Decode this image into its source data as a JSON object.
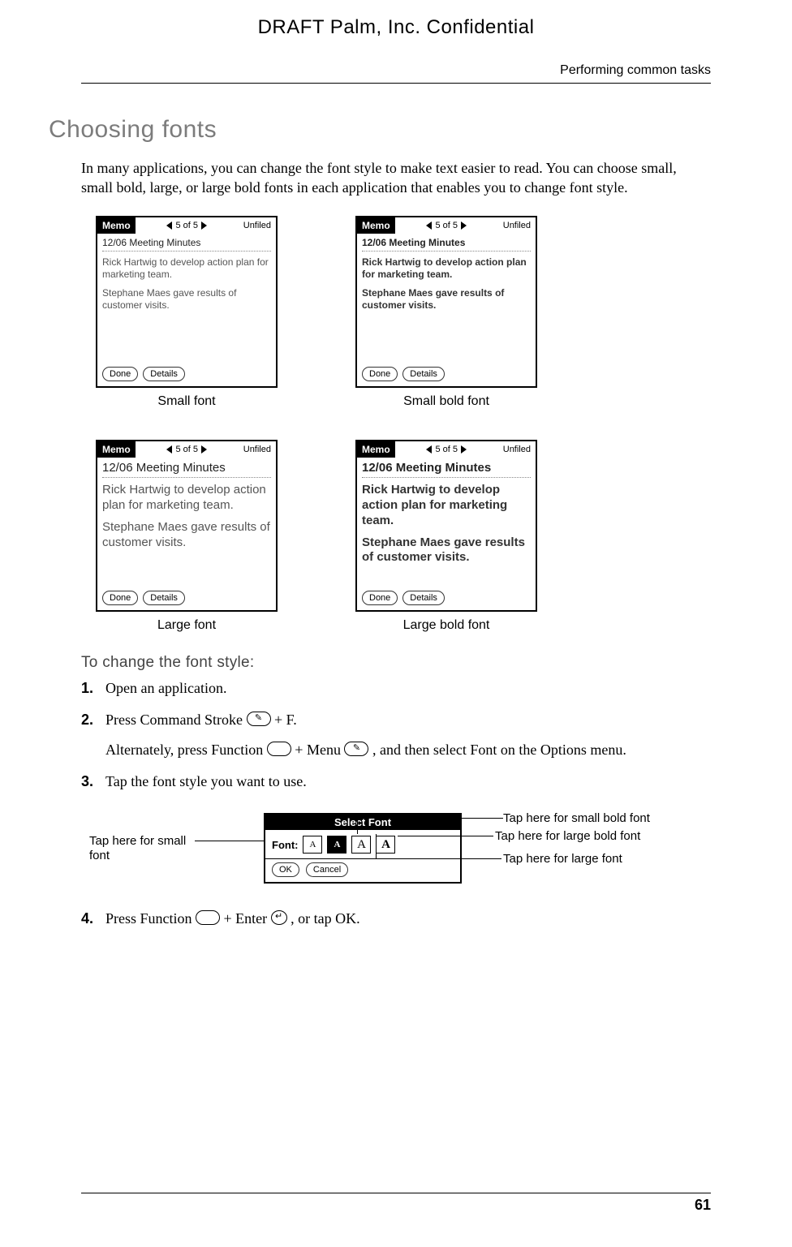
{
  "header": {
    "draft": "DRAFT   Palm, Inc. Confidential",
    "running": "Performing common tasks"
  },
  "section": {
    "title": "Choosing fonts",
    "intro": "In many applications, you can change the font style to make text easier to read. You can choose small, small bold, large, or large bold fonts in each application that enables you to change font style."
  },
  "memo": {
    "app": "Memo",
    "counter": "5 of 5",
    "category": "Unfiled",
    "title": "12/06 Meeting Minutes",
    "para1": "Rick Hartwig to develop action plan for marketing team.",
    "para2": "Stephane Maes gave results of customer visits.",
    "done": "Done",
    "details": "Details"
  },
  "captions": {
    "small": "Small font",
    "small_bold": "Small bold font",
    "large": "Large font",
    "large_bold": "Large bold font"
  },
  "procedure": {
    "heading": "To change the font style:",
    "steps": {
      "s1": "Open an application.",
      "s2a": "Press Command Stroke ",
      "s2b": " + F.",
      "s2alt_a": "Alternately, press Function ",
      "s2alt_b": " + Menu ",
      "s2alt_c": ", and then select Font on the Options menu.",
      "s3": "Tap the font style you want to use.",
      "s4a": "Press Function ",
      "s4b": " + Enter ",
      "s4c": ", or tap OK."
    }
  },
  "dialog": {
    "title": "Select Font",
    "label": "Font:",
    "ok": "OK",
    "cancel": "Cancel",
    "opts": {
      "a": "A",
      "b": "A",
      "c": "A",
      "d": "A"
    }
  },
  "callouts": {
    "left": "Tap here for small font",
    "r1": "Tap here for small bold font",
    "r2": "Tap here for large bold font",
    "r3": "Tap here for large font"
  },
  "footer": {
    "page": "61"
  }
}
